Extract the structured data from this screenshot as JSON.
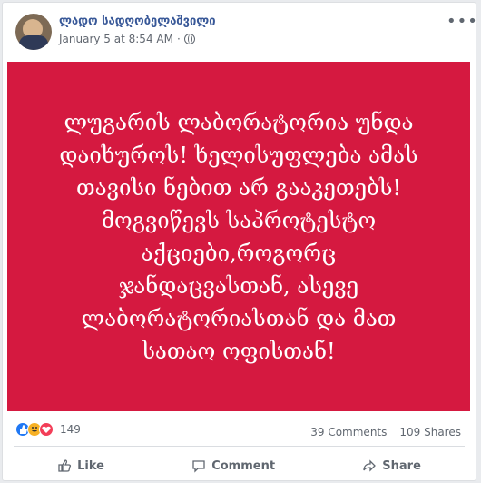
{
  "post": {
    "author": "ლადო სადღობელაშვილი",
    "date": "January 5 at 8:54 AM",
    "text": "ლუგარის ლაბორატორია უნდა\nდაიხუროს! ხელისუფლება ამას\nთავისი ნებით არ გააკეთებს!\nმოგვიწევს საპროტესტო\nაქციები,როგორც\nჯანდაცვასთან, ასევე\nლაბორატორიასთან და მათ\nსათაო ოფისთან!",
    "bg_color": "#d51940"
  },
  "reactions": {
    "count": "149"
  },
  "stats": {
    "comments": "39 Comments",
    "shares": "109 Shares"
  },
  "actions": {
    "like": "Like",
    "comment": "Comment",
    "share": "Share"
  }
}
